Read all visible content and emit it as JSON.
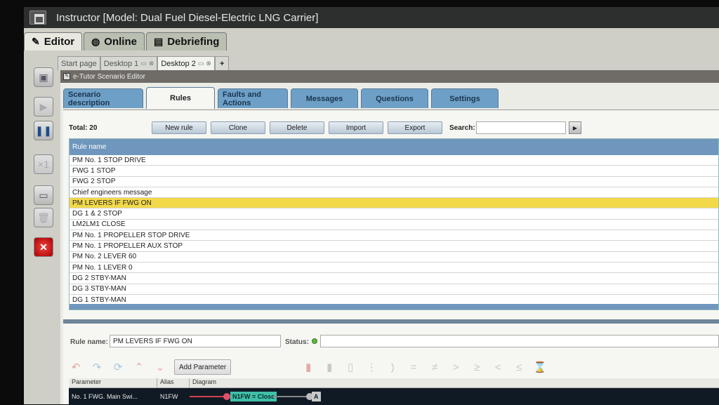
{
  "window": {
    "title": "Instructor [Model: Dual Fuel Diesel-Electric LNG Carrier]"
  },
  "modes": [
    {
      "label": "Editor",
      "icon": "pencil-icon"
    },
    {
      "label": "Online",
      "icon": "globe-icon"
    },
    {
      "label": "Debriefing",
      "icon": "book-icon"
    }
  ],
  "desktop_tabs": [
    "Start page",
    "Desktop 1",
    "Desktop 2",
    "+"
  ],
  "editor": {
    "title": "e-Tutor Scenario Editor"
  },
  "section_tabs": [
    "Scenario description",
    "Rules",
    "Faults and Actions",
    "Messages",
    "Questions",
    "Settings"
  ],
  "toolbar": {
    "total": "Total: 20",
    "buttons": [
      "New rule",
      "Clone",
      "Delete",
      "Import",
      "Export"
    ],
    "search_label": "Search:",
    "search_value": ""
  },
  "grid": {
    "header": "Rule name",
    "rows": [
      "PM No. 1 STOP DRIVE",
      "FWG 1 STOP",
      "FWG 2 STOP",
      "Chief engineers message",
      "PM LEVERS IF FWG ON",
      "DG 1 & 2 STOP",
      "LM2LM1 CLOSE",
      "PM No. 1 PROPELLER STOP DRIVE",
      "PM No. 1 PROPELLER AUX STOP",
      "PM No. 2 LEVER 60",
      "PM No. 1 LEVER 0",
      "DG 2 STBY-MAN",
      "DG 3 STBY-MAN",
      "DG 1 STBY-MAN"
    ],
    "selected_index": 4
  },
  "detail": {
    "rule_name_label": "Rule name:",
    "rule_name_value": "PM LEVERS IF FWG ON",
    "status_label": "Status:",
    "add_parameter": "Add Parameter",
    "logic_symbols": [
      "=",
      "≠",
      ">",
      "≥",
      "<",
      "≤"
    ]
  },
  "params": {
    "columns": [
      "Parameter",
      "Alias",
      "Diagram"
    ],
    "row": {
      "parameter": "No. 1 FWG. Main Swi...",
      "alias": "N1FW",
      "condition": "N1FW = Close",
      "gate": "A"
    }
  }
}
